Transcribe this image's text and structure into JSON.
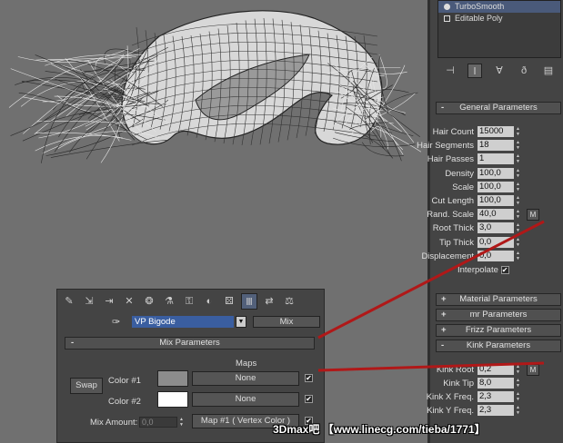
{
  "modifier_stack": {
    "items": [
      {
        "label": "TurboSmooth",
        "icon": "bulb-icon",
        "selected": true
      },
      {
        "label": "Editable Poly",
        "icon": "poly-object-icon",
        "selected": false
      }
    ]
  },
  "stack_tools": [
    {
      "icon": "pin-stack-icon",
      "glyph": "⊣"
    },
    {
      "icon": "show-end-result-icon",
      "glyph": "Ⅰ"
    },
    {
      "icon": "make-unique-icon",
      "glyph": "∀"
    },
    {
      "icon": "remove-modifier-icon",
      "glyph": "ð"
    },
    {
      "icon": "configure-sets-icon",
      "glyph": "▤"
    }
  ],
  "general_parameters": {
    "title": "General Parameters",
    "sign": "-",
    "params": [
      {
        "label": "Hair Count",
        "value": "15000",
        "has_map": false
      },
      {
        "label": "Hair Segments",
        "value": "18",
        "has_map": false
      },
      {
        "label": "Hair Passes",
        "value": "1",
        "has_map": false
      },
      {
        "label": "Density",
        "value": "100,0",
        "has_map": false
      },
      {
        "label": "Scale",
        "value": "100,0",
        "has_map": false
      },
      {
        "label": "Cut Length",
        "value": "100,0",
        "has_map": false
      },
      {
        "label": "Rand. Scale",
        "value": "40,0",
        "has_map": true
      },
      {
        "label": "Root Thick",
        "value": "3,0",
        "has_map": false
      },
      {
        "label": "Tip Thick",
        "value": "0,0",
        "has_map": false
      },
      {
        "label": "Displacement",
        "value": "0,0",
        "has_map": false
      }
    ],
    "interpolate_label": "Interpolate",
    "interpolate_checked": "✔",
    "map_button_label": "M"
  },
  "collapsed_rollouts": [
    {
      "title": "Material Parameters",
      "sign": "+"
    },
    {
      "title": "mr Parameters",
      "sign": "+"
    },
    {
      "title": "Frizz Parameters",
      "sign": "+"
    }
  ],
  "kink_parameters": {
    "title": "Kink Parameters",
    "sign": "-",
    "params": [
      {
        "label": "Kink Root",
        "value": "0,2",
        "has_map": true
      },
      {
        "label": "Kink Tip",
        "value": "8,0",
        "has_map": false
      },
      {
        "label": "Kink X Freq.",
        "value": "2,3",
        "has_map": false
      },
      {
        "label": "Kink Y Freq.",
        "value": "2,3",
        "has_map": false
      }
    ]
  },
  "material_editor": {
    "toolbar": [
      {
        "icon": "get-material-icon",
        "glyph": "✎"
      },
      {
        "icon": "put-to-scene-icon",
        "glyph": "⇲"
      },
      {
        "icon": "assign-material-icon",
        "glyph": "⇥"
      },
      {
        "icon": "delete-icon",
        "glyph": "✕"
      },
      {
        "icon": "make-unique-icon",
        "glyph": "❂"
      },
      {
        "icon": "put-to-library-icon",
        "glyph": "⚗"
      },
      {
        "icon": "material-id-icon",
        "glyph": "⚿"
      },
      {
        "icon": "show-map-icon",
        "glyph": "◐"
      },
      {
        "icon": "show-end-result-icon",
        "glyph": "⚄"
      },
      {
        "icon": "go-to-parent-icon",
        "glyph": "Ⅲ"
      },
      {
        "icon": "go-forward-sibling-icon",
        "glyph": "⇄"
      },
      {
        "icon": "material-map-navigator-icon",
        "glyph": "⚖"
      }
    ],
    "material_name": "VP Bigode",
    "dropdown_glyph": "▼",
    "material_type": "Mix",
    "rollout_title": "Mix Parameters",
    "rollout_sign": "-",
    "maps_header": "Maps",
    "swap_label": "Swap",
    "color1_label": "Color #1",
    "color1_hex": "#8c8c8c",
    "color1_map": "None",
    "color2_label": "Color #2",
    "color2_hex": "#ffffff",
    "color2_map": "None",
    "mix_amount_label": "Mix Amount:",
    "mix_amount_value": "0,0",
    "mix_map": "Map #1  ( Vertex Color )",
    "checked_glyph": "✔"
  },
  "watermark": {
    "text": "3Dmax吧 【www.linecg.com/tieba/1771】"
  },
  "colors": {
    "annotation_red": "#b01818",
    "selection_blue": "#3a5ea0"
  }
}
